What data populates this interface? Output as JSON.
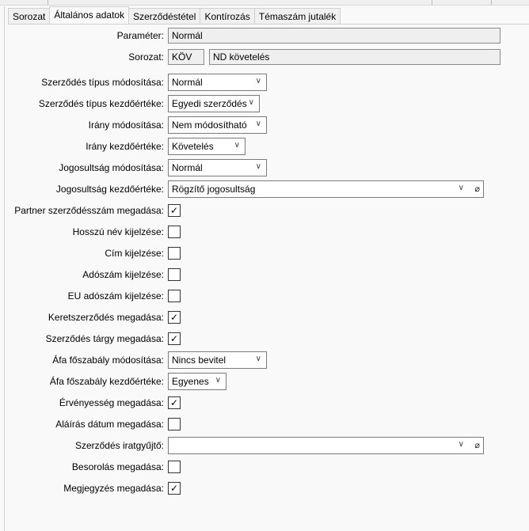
{
  "tabs": [
    "Sorozat",
    "Általános adatok",
    "Szerződéstétel",
    "Kontírozás",
    "Témaszám jutalék"
  ],
  "active_tab": "Általános adatok",
  "parameter": {
    "label": "Paraméter:",
    "value": "Normál"
  },
  "sorozat": {
    "label": "Sorozat:",
    "code": "KÖV",
    "name": "ND követelés"
  },
  "fields": [
    {
      "label": "Szerződés típus módosítása:",
      "type": "select",
      "value": "Normál"
    },
    {
      "label": "Szerződés típus kezdőértéke:",
      "type": "select",
      "value": "Egyedi szerződés"
    },
    {
      "label": "Irány módosítása:",
      "type": "select",
      "value": "Nem módosítható"
    },
    {
      "label": "Irány kezdőértéke:",
      "type": "select",
      "value": "Követelés"
    },
    {
      "label": "Jogosultság módosítása:",
      "type": "select",
      "value": "Normál"
    },
    {
      "label": "Jogosultság kezdőértéke:",
      "type": "lookup",
      "value": "Rögzítő jogosultság"
    },
    {
      "label": "Partner szerződésszám megadása:",
      "type": "check",
      "checked": true
    },
    {
      "label": "Hosszú név kijelzése:",
      "type": "check",
      "checked": false
    },
    {
      "label": "Cím kijelzése:",
      "type": "check",
      "checked": false
    },
    {
      "label": "Adószám kijelzése:",
      "type": "check",
      "checked": false
    },
    {
      "label": "EU adószám kijelzése:",
      "type": "check",
      "checked": false
    },
    {
      "label": "Keretszerződés megadása:",
      "type": "check",
      "checked": true
    },
    {
      "label": "Szerződés tárgy megadása:",
      "type": "check",
      "checked": true
    },
    {
      "label": "Áfa főszabály módosítása:",
      "type": "select",
      "value": "Nincs bevitel"
    },
    {
      "label": "Áfa főszabály kezdőértéke:",
      "type": "select",
      "value": "Egyenes"
    },
    {
      "label": "Érvényesség megadása:",
      "type": "check",
      "checked": true
    },
    {
      "label": "Aláírás dátum megadása:",
      "type": "check",
      "checked": false
    },
    {
      "label": "Szerződés iratgyűjtő:",
      "type": "lookup",
      "value": ""
    },
    {
      "label": "Besorolás megadása:",
      "type": "check",
      "checked": false
    },
    {
      "label": "Megjegyzés megadása:",
      "type": "check",
      "checked": true
    }
  ]
}
